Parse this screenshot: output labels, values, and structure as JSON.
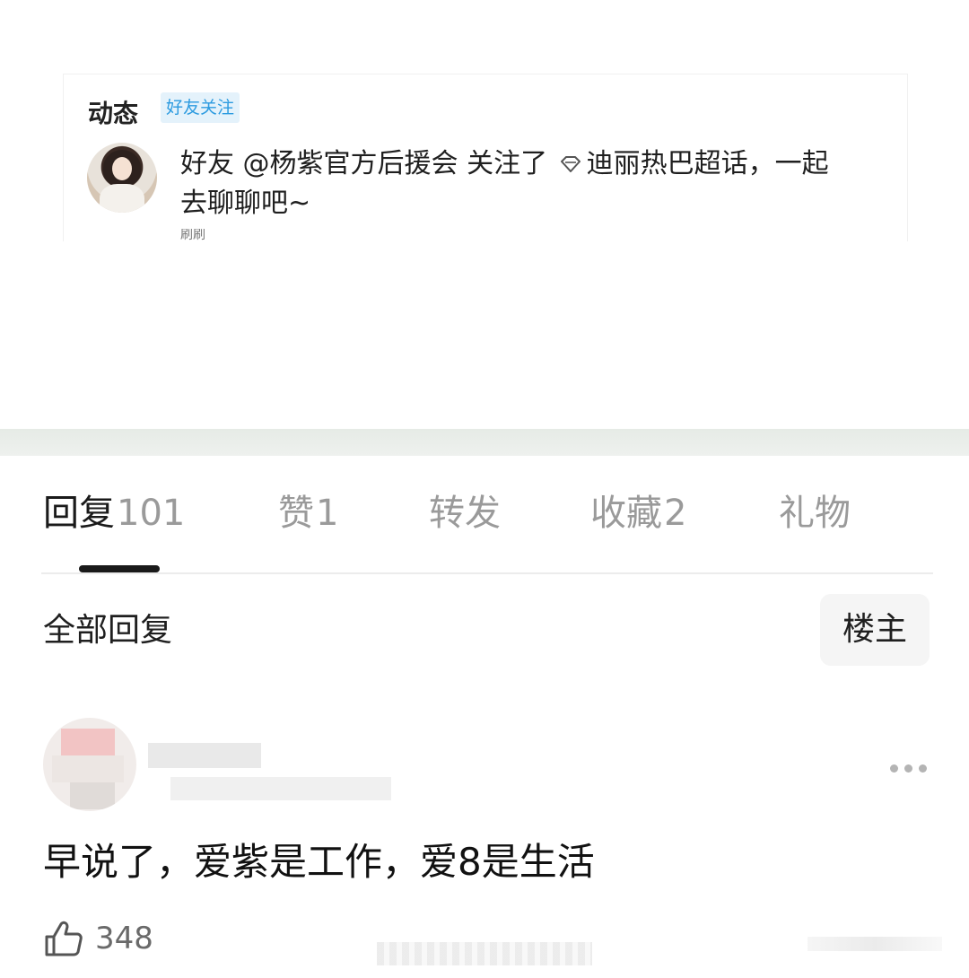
{
  "activity_card": {
    "title": "动态",
    "badge": "好友关注",
    "message_line1": "好友 @杨紫官方后援会 关注了",
    "topic": "迪丽热巴超话",
    "message_tail": "，一起",
    "message_line2": "去聊聊吧~",
    "partial_text": "刷刷"
  },
  "tabs": [
    {
      "label": "回复",
      "count": "101"
    },
    {
      "label": "赞",
      "count": "1"
    },
    {
      "label": "转发",
      "count": ""
    },
    {
      "label": "收藏",
      "count": "2"
    },
    {
      "label": "礼物",
      "count": ""
    }
  ],
  "filter": {
    "label": "全部回复",
    "op_button": "楼主"
  },
  "comment": {
    "text": "早说了，爱紫是工作，爱8是生活",
    "likes": "348"
  },
  "colors": {
    "badge_bg": "#e4f2fb",
    "badge_text": "#2c9be0",
    "tab_active": "#1a1a1a",
    "tab_inactive": "#9a9a9a"
  }
}
